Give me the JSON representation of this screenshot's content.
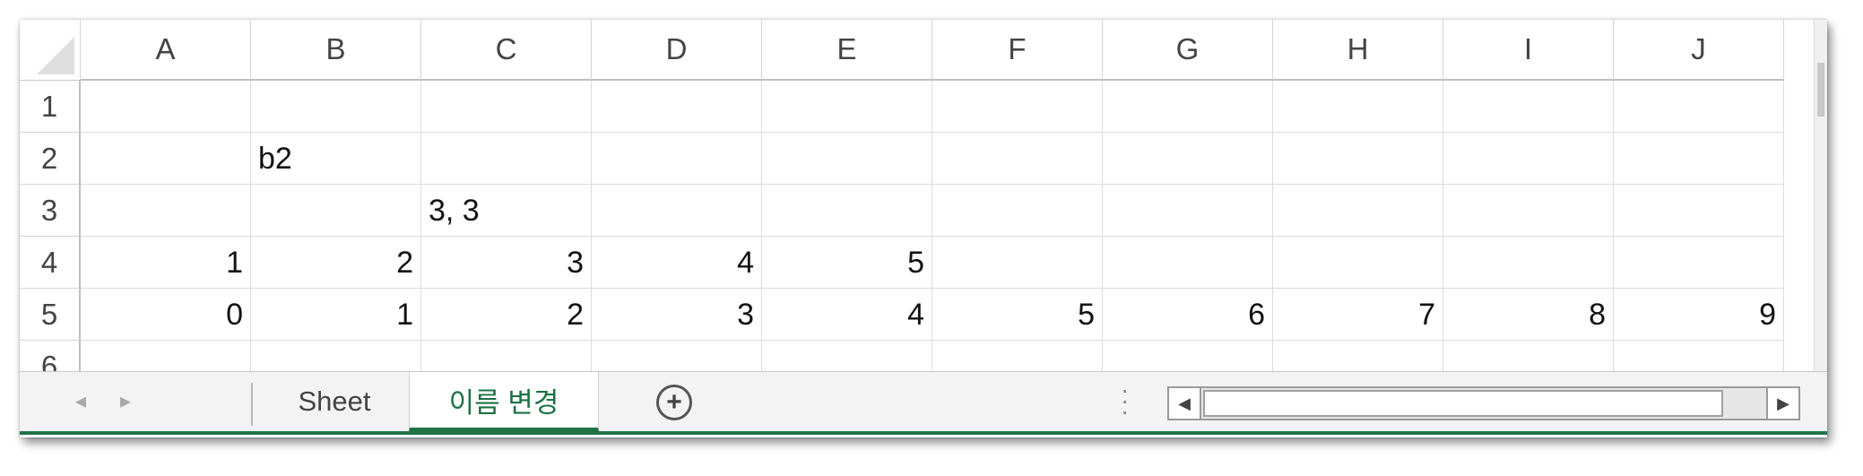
{
  "columns": [
    "A",
    "B",
    "C",
    "D",
    "E",
    "F",
    "G",
    "H",
    "I",
    "J"
  ],
  "rows": [
    "1",
    "2",
    "3",
    "4",
    "5",
    "6"
  ],
  "cells": [
    [
      "",
      "",
      "",
      "",
      "",
      "",
      "",
      "",
      "",
      ""
    ],
    [
      "",
      "b2",
      "",
      "",
      "",
      "",
      "",
      "",
      "",
      ""
    ],
    [
      "",
      "",
      "3, 3",
      "",
      "",
      "",
      "",
      "",
      "",
      ""
    ],
    [
      "1",
      "2",
      "3",
      "4",
      "5",
      "",
      "",
      "",
      "",
      ""
    ],
    [
      "0",
      "1",
      "2",
      "3",
      "4",
      "5",
      "6",
      "7",
      "8",
      "9"
    ],
    [
      "",
      "",
      "",
      "",
      "",
      "",
      "",
      "",
      "",
      ""
    ]
  ],
  "tabs": {
    "sheet1": "Sheet",
    "sheet2": "이름 변경",
    "add": "+"
  },
  "icons": {
    "nav_prev": "triangle-left",
    "nav_next": "triangle-right",
    "scroll_left": "triangle-left",
    "scroll_right": "triangle-right",
    "more": "vertical-ellipsis"
  },
  "colors": {
    "accent": "#217346"
  }
}
